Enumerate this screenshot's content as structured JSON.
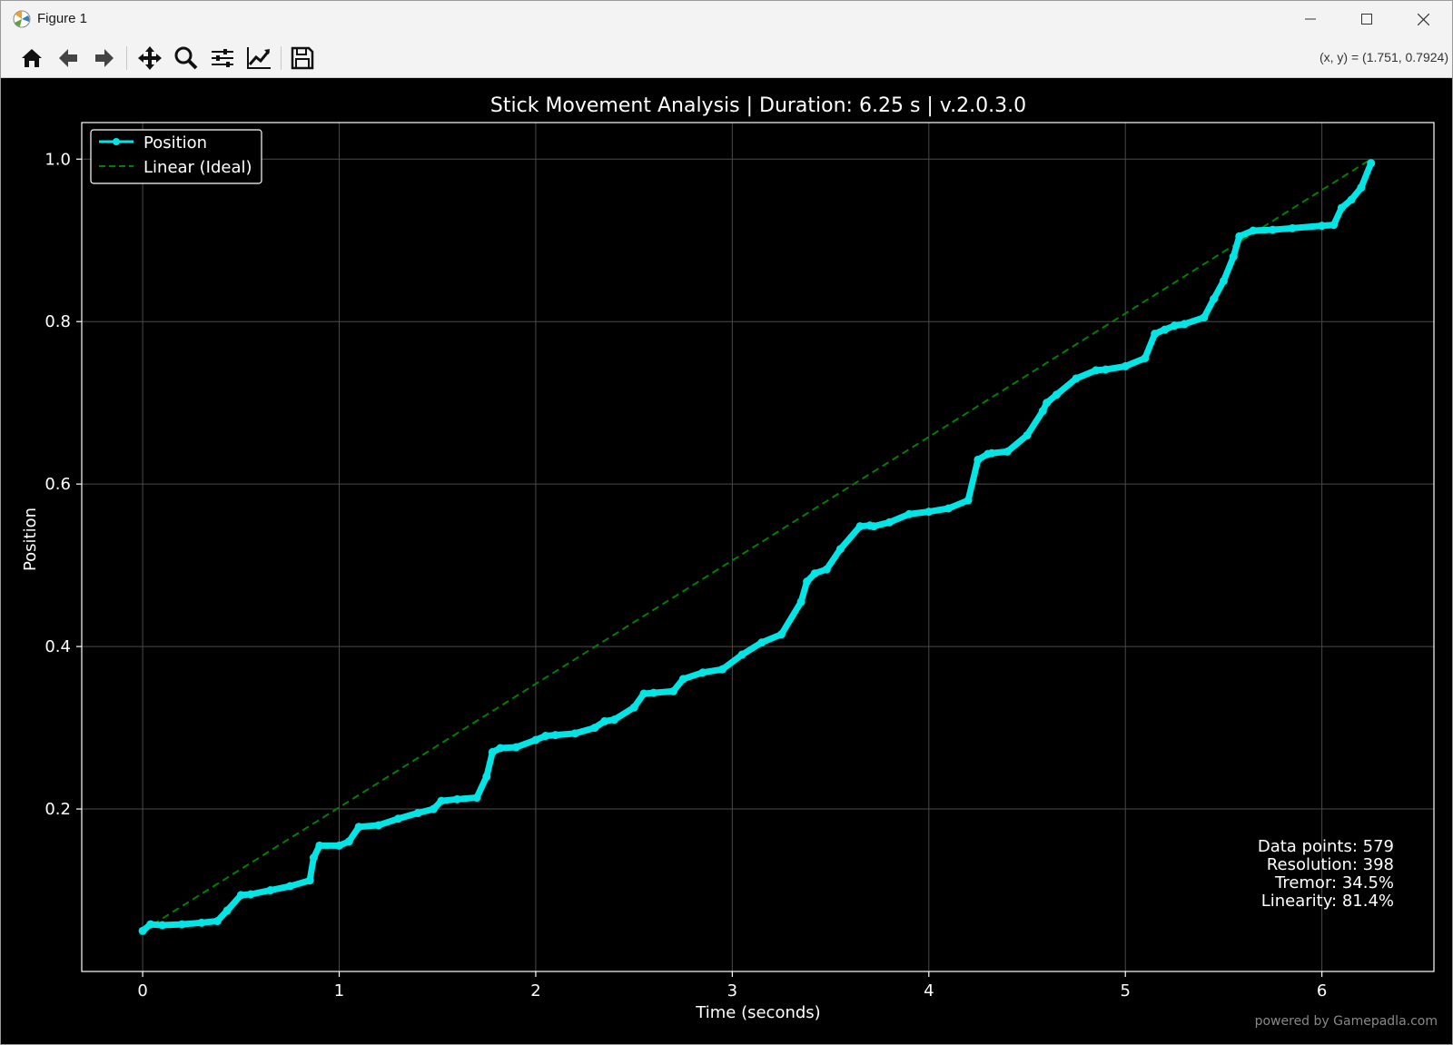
{
  "window": {
    "title": "Figure 1"
  },
  "toolbar": {
    "coords": "(x, y) = (1.751, 0.7924)",
    "buttons": [
      "home-icon",
      "back-arrow-icon",
      "forward-arrow-icon",
      "pan-icon",
      "zoom-icon",
      "subplots-icon",
      "edit-axis-icon",
      "save-icon"
    ]
  },
  "watermark": "powered by Gamepadla.com",
  "chart_data": {
    "type": "line",
    "title": "Stick Movement Analysis | Duration: 6.25 s | v.2.0.3.0",
    "xlabel": "Time (seconds)",
    "ylabel": "Position",
    "xlim": [
      -0.31,
      6.57
    ],
    "ylim": [
      0.0,
      1.045
    ],
    "xticks": [
      0,
      1,
      2,
      3,
      4,
      5,
      6
    ],
    "yticks": [
      0.2,
      0.4,
      0.6,
      0.8,
      1.0
    ],
    "ytick_labels": [
      "0.2",
      "0.4",
      "0.6",
      "0.8",
      "1.0"
    ],
    "grid": true,
    "legend": {
      "placement": "upper-left",
      "entries": [
        "Position",
        "Linear (Ideal)"
      ]
    },
    "colors": {
      "position": "#00e5e5",
      "linear": "#008000",
      "background": "#000000",
      "foreground": "#ffffff"
    },
    "series": [
      {
        "name": "Position",
        "style": "solid-with-markers",
        "x": [
          0.0,
          0.04,
          0.1,
          0.2,
          0.3,
          0.38,
          0.43,
          0.5,
          0.55,
          0.65,
          0.75,
          0.85,
          0.87,
          0.9,
          1.0,
          1.05,
          1.1,
          1.2,
          1.3,
          1.4,
          1.48,
          1.52,
          1.6,
          1.7,
          1.75,
          1.78,
          1.82,
          1.9,
          2.0,
          2.05,
          2.1,
          2.2,
          2.3,
          2.35,
          2.4,
          2.5,
          2.55,
          2.6,
          2.7,
          2.75,
          2.85,
          2.95,
          3.05,
          3.15,
          3.25,
          3.35,
          3.38,
          3.42,
          3.48,
          3.55,
          3.65,
          3.7,
          3.72,
          3.8,
          3.9,
          4.0,
          4.1,
          4.2,
          4.25,
          4.3,
          4.32,
          4.4,
          4.5,
          4.58,
          4.6,
          4.65,
          4.75,
          4.85,
          4.9,
          5.0,
          5.1,
          5.15,
          5.2,
          5.25,
          5.3,
          5.4,
          5.45,
          5.5,
          5.55,
          5.58,
          5.65,
          5.75,
          5.85,
          6.0,
          6.06,
          6.1,
          6.15,
          6.2,
          6.25
        ],
        "y": [
          0.05,
          0.058,
          0.057,
          0.058,
          0.06,
          0.062,
          0.075,
          0.094,
          0.095,
          0.1,
          0.105,
          0.112,
          0.14,
          0.155,
          0.155,
          0.16,
          0.178,
          0.18,
          0.188,
          0.195,
          0.2,
          0.21,
          0.212,
          0.214,
          0.24,
          0.27,
          0.275,
          0.276,
          0.285,
          0.29,
          0.291,
          0.293,
          0.3,
          0.308,
          0.31,
          0.325,
          0.342,
          0.343,
          0.345,
          0.36,
          0.368,
          0.372,
          0.39,
          0.405,
          0.415,
          0.455,
          0.48,
          0.49,
          0.495,
          0.52,
          0.548,
          0.549,
          0.548,
          0.553,
          0.563,
          0.566,
          0.57,
          0.58,
          0.63,
          0.637,
          0.638,
          0.64,
          0.66,
          0.69,
          0.7,
          0.71,
          0.73,
          0.74,
          0.741,
          0.745,
          0.755,
          0.785,
          0.79,
          0.795,
          0.797,
          0.805,
          0.828,
          0.85,
          0.88,
          0.905,
          0.912,
          0.913,
          0.915,
          0.918,
          0.919,
          0.94,
          0.95,
          0.965,
          0.995
        ]
      },
      {
        "name": "Linear (Ideal)",
        "style": "dashed",
        "x": [
          0.0,
          6.25
        ],
        "y": [
          0.05,
          1.0
        ]
      }
    ],
    "annotations": [
      "Data points: 579",
      "Resolution: 398",
      "Tremor: 34.5%",
      "Linearity: 81.4%"
    ]
  }
}
